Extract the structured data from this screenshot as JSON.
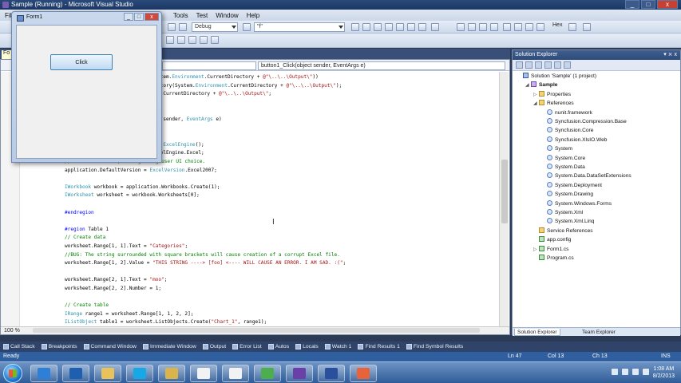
{
  "window": {
    "title": "Sample (Running) - Microsoft Visual Studio",
    "btn_min": "_",
    "btn_max": "□",
    "btn_close": "x"
  },
  "menu": [
    "File",
    "Tools",
    "Test",
    "Window",
    "Help"
  ],
  "toolbar": {
    "config_combo": "Debug",
    "find_combo": "\"f\"",
    "hex_label": "Hex"
  },
  "editor": {
    "doc_tab": "Fo",
    "nav_left": "",
    "nav_right": "button1_Click(object sender, EventArgs e)",
    "zoom": "100 %",
    "lines": [
      [
        [
          "plain",
          "stem."
        ],
        [
          "ty",
          "Environment"
        ],
        [
          "plain",
          ".CurrentDirectory + "
        ],
        [
          "str",
          "@\"\\..\\..\\Output\\\""
        ],
        [
          "plain",
          "))"
        ]
      ],
      [
        [
          "plain",
          "ctory(System."
        ],
        [
          "ty",
          "Environment"
        ],
        [
          "plain",
          ".CurrentDirectory + "
        ],
        [
          "str",
          "@\"\\..\\..\\Output\\\""
        ],
        [
          "plain",
          ");"
        ]
      ],
      [
        [
          "plain",
          "t.CurrentDirectory + "
        ],
        [
          "str",
          "@\"\\..\\..\\Output\\\""
        ],
        [
          "plain",
          ";"
        ]
      ],
      [
        [
          "plain",
          ""
        ]
      ],
      [
        [
          "plain",
          ""
        ]
      ],
      [
        [
          "plain",
          "t sender, "
        ],
        [
          "ty",
          "EventArgs"
        ],
        [
          "plain",
          " e)"
        ]
      ],
      [
        [
          "plain",
          ""
        ]
      ],
      [
        [
          "plain",
          ""
        ]
      ],
      [
        [
          "plain",
          "w "
        ],
        [
          "ty",
          "ExcelEngine"
        ],
        [
          "plain",
          "();"
        ]
      ],
      [
        [
          "plain",
          "celEngine.Excel;"
        ]
      ],
      [
        [
          "cm",
          "// I do Excel 2010, disregarding user UI choice."
        ]
      ],
      [
        [
          "plain",
          "application.DefaultVersion = "
        ],
        [
          "ty",
          "ExcelVersion"
        ],
        [
          "plain",
          ".Excel2007;"
        ]
      ],
      [
        [
          "plain",
          ""
        ]
      ],
      [
        [
          "ty",
          "IWorkbook"
        ],
        [
          "plain",
          " workbook = application.Workbooks.Create(1);"
        ]
      ],
      [
        [
          "ty",
          "IWorksheet"
        ],
        [
          "plain",
          " worksheet = workbook.Worksheets[0];"
        ]
      ],
      [
        [
          "plain",
          ""
        ]
      ],
      [
        [
          "kw",
          "#endregion"
        ]
      ],
      [
        [
          "plain",
          ""
        ]
      ],
      [
        [
          "kw",
          "#region"
        ],
        [
          "plain",
          " Table 1"
        ]
      ],
      [
        [
          "cm",
          "// Create data"
        ]
      ],
      [
        [
          "plain",
          "worksheet.Range[1, 1].Text = "
        ],
        [
          "str",
          "\"Categories\""
        ],
        [
          "plain",
          ";"
        ]
      ],
      [
        [
          "cm",
          "//BUG: The string surrounded with square brackets will cause creation of a corrupt Excel file."
        ]
      ],
      [
        [
          "plain",
          "worksheet.Range[1, 2].Value = "
        ],
        [
          "str",
          "\"THIS STRING ----> [foo] <---- WILL CAUSE AN ERROR. I AM SAD. :(\""
        ],
        [
          "plain",
          ";"
        ]
      ],
      [
        [
          "plain",
          ""
        ]
      ],
      [
        [
          "plain",
          "worksheet.Range[2, 1].Text = "
        ],
        [
          "str",
          "\"moo\""
        ],
        [
          "plain",
          ";"
        ]
      ],
      [
        [
          "plain",
          "worksheet.Range[2, 2].Number = 1;"
        ]
      ],
      [
        [
          "plain",
          ""
        ]
      ],
      [
        [
          "cm",
          "// Create table"
        ]
      ],
      [
        [
          "ty",
          "IRange"
        ],
        [
          "plain",
          " range1 = worksheet.Range[1, 1, 2, 2];"
        ]
      ],
      [
        [
          "ty",
          "IListObject"
        ],
        [
          "plain",
          " table1 = worksheet.ListObjects.Create("
        ],
        [
          "str",
          "\"Chart_1\""
        ],
        [
          "plain",
          ", range1);"
        ]
      ]
    ]
  },
  "form1": {
    "title": "Form1",
    "button_label": "Click"
  },
  "solution_explorer": {
    "title": "Solution Explorer",
    "pins": "▾ ⨯ x",
    "nodes": [
      {
        "label": "Solution 'Sample' (1 project)",
        "indent": 0,
        "icon": "sln",
        "exp": ""
      },
      {
        "label": "Sample",
        "indent": 1,
        "icon": "proj",
        "exp": "◢",
        "bold": true
      },
      {
        "label": "Properties",
        "indent": 2,
        "icon": "folder",
        "exp": "▷"
      },
      {
        "label": "References",
        "indent": 2,
        "icon": "folder",
        "exp": "◢"
      },
      {
        "label": "nunit.framework",
        "indent": 3,
        "icon": "ref",
        "exp": ""
      },
      {
        "label": "Syncfusion.Compression.Base",
        "indent": 3,
        "icon": "ref",
        "exp": ""
      },
      {
        "label": "Syncfusion.Core",
        "indent": 3,
        "icon": "ref",
        "exp": ""
      },
      {
        "label": "Syncfusion.XlsIO.Web",
        "indent": 3,
        "icon": "ref",
        "exp": ""
      },
      {
        "label": "System",
        "indent": 3,
        "icon": "ref",
        "exp": ""
      },
      {
        "label": "System.Core",
        "indent": 3,
        "icon": "ref",
        "exp": ""
      },
      {
        "label": "System.Data",
        "indent": 3,
        "icon": "ref",
        "exp": ""
      },
      {
        "label": "System.Data.DataSetExtensions",
        "indent": 3,
        "icon": "ref",
        "exp": ""
      },
      {
        "label": "System.Deployment",
        "indent": 3,
        "icon": "ref",
        "exp": ""
      },
      {
        "label": "System.Drawing",
        "indent": 3,
        "icon": "ref",
        "exp": ""
      },
      {
        "label": "System.Windows.Forms",
        "indent": 3,
        "icon": "ref",
        "exp": ""
      },
      {
        "label": "System.Xml",
        "indent": 3,
        "icon": "ref",
        "exp": ""
      },
      {
        "label": "System.Xml.Linq",
        "indent": 3,
        "icon": "ref",
        "exp": ""
      },
      {
        "label": "Service References",
        "indent": 2,
        "icon": "folder",
        "exp": ""
      },
      {
        "label": "app.config",
        "indent": 2,
        "icon": "cs",
        "exp": ""
      },
      {
        "label": "Form1.cs",
        "indent": 2,
        "icon": "cs",
        "exp": "▷"
      },
      {
        "label": "Program.cs",
        "indent": 2,
        "icon": "cs",
        "exp": ""
      }
    ],
    "tab_solution": "Solution Explorer",
    "tab_team": "Team Explorer"
  },
  "tool_tabs": [
    "Call Stack",
    "Breakpoints",
    "Command Window",
    "Immediate Window",
    "Output",
    "Error List",
    "Autos",
    "Locals",
    "Watch 1",
    "Find Results 1",
    "Find Symbol Results"
  ],
  "status": {
    "ready": "Ready",
    "ln": "Ln 47",
    "col": "Col 13",
    "ch": "Ch 13",
    "ins": "INS"
  },
  "taskbar": {
    "clock_time": "1:08 AM",
    "clock_date": "8/2/2013",
    "apps": [
      {
        "name": "ie-icon",
        "color": "#2e7fd6"
      },
      {
        "name": "outlook-icon",
        "color": "#1f5fb0"
      },
      {
        "name": "explorer-icon",
        "color": "#e9c25a"
      },
      {
        "name": "skype-icon",
        "color": "#17a8e6"
      },
      {
        "name": "folder-icon",
        "color": "#d8b44a"
      },
      {
        "name": "dashlane-icon",
        "color": "#f2f2f2"
      },
      {
        "name": "dashlane2-icon",
        "color": "#f2f2f2"
      },
      {
        "name": "chrome-icon",
        "color": "#4cae4c"
      },
      {
        "name": "visual-studio-icon",
        "color": "#6b3fa8"
      },
      {
        "name": "tfs-icon",
        "color": "#2a4f9c"
      },
      {
        "name": "windows-app-icon",
        "color": "#e8623a"
      }
    ]
  }
}
